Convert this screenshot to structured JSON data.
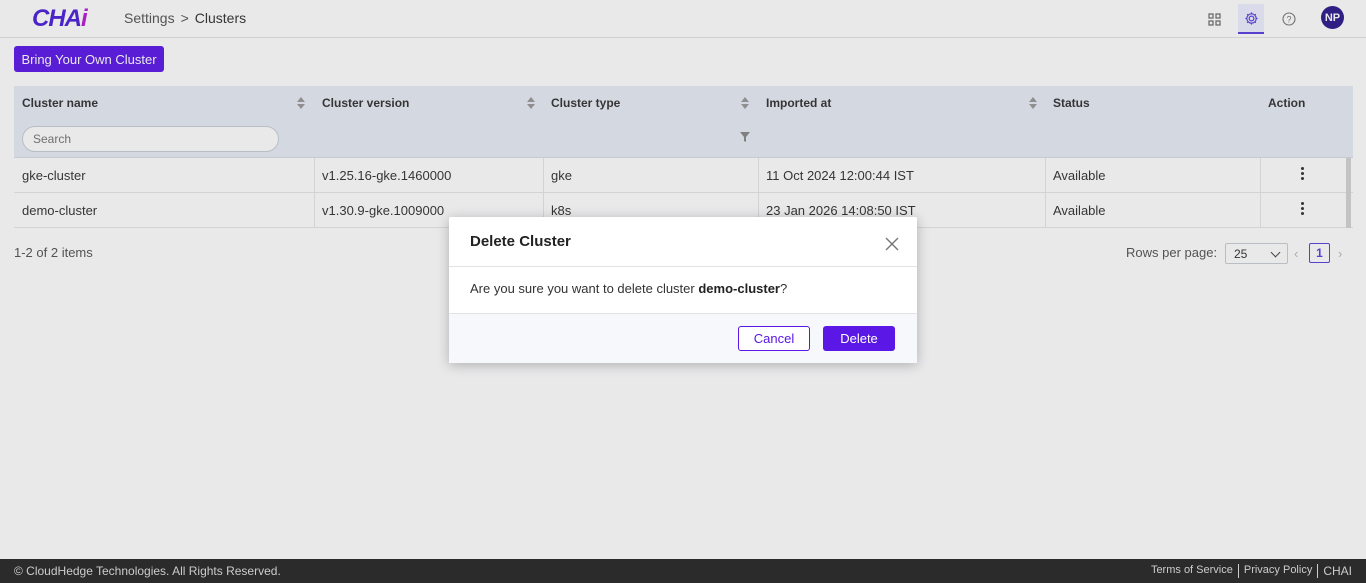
{
  "header": {
    "logo_main": "CHA",
    "logo_accent": "i",
    "breadcrumb": [
      "Settings",
      "Clusters"
    ],
    "icons": [
      "apps-grid-icon",
      "settings-gear-icon",
      "help-circle-icon"
    ],
    "avatar_initials": "NP"
  },
  "toolbar": {
    "byoc_label": "Bring Your Own Cluster"
  },
  "table": {
    "columns": [
      "Cluster name",
      "Cluster version",
      "Cluster type",
      "Imported at",
      "Status",
      "Action"
    ],
    "search_placeholder": "Search",
    "rows": [
      {
        "name": "gke-cluster",
        "version": "v1.25.16-gke.1460000",
        "type": "gke",
        "imported": "11 Oct 2024 12:00:44 IST",
        "status": "Available"
      },
      {
        "name": "demo-cluster",
        "version": "v1.30.9-gke.1009000",
        "type": "k8s",
        "imported": "23 Jan 2026 14:08:50 IST",
        "status": "Available"
      }
    ]
  },
  "pagination": {
    "items_text": "1-2 of 2 items",
    "rows_per_page_label": "Rows per page:",
    "rows_per_page_value": "25",
    "current_page": "1"
  },
  "modal": {
    "title": "Delete Cluster",
    "message_prefix": "Are you sure you want to delete cluster ",
    "message_target": "demo-cluster",
    "message_suffix": "?",
    "cancel_label": "Cancel",
    "delete_label": "Delete"
  },
  "footer": {
    "copyright": "© CloudHedge Technologies. All Rights Reserved.",
    "links": [
      "Terms of Service",
      "Privacy Policy",
      "CHAI"
    ]
  },
  "colors": {
    "accent": "#5a17e6",
    "header_bg": "#e8edf5",
    "footer_bg": "#2b2b2b"
  }
}
